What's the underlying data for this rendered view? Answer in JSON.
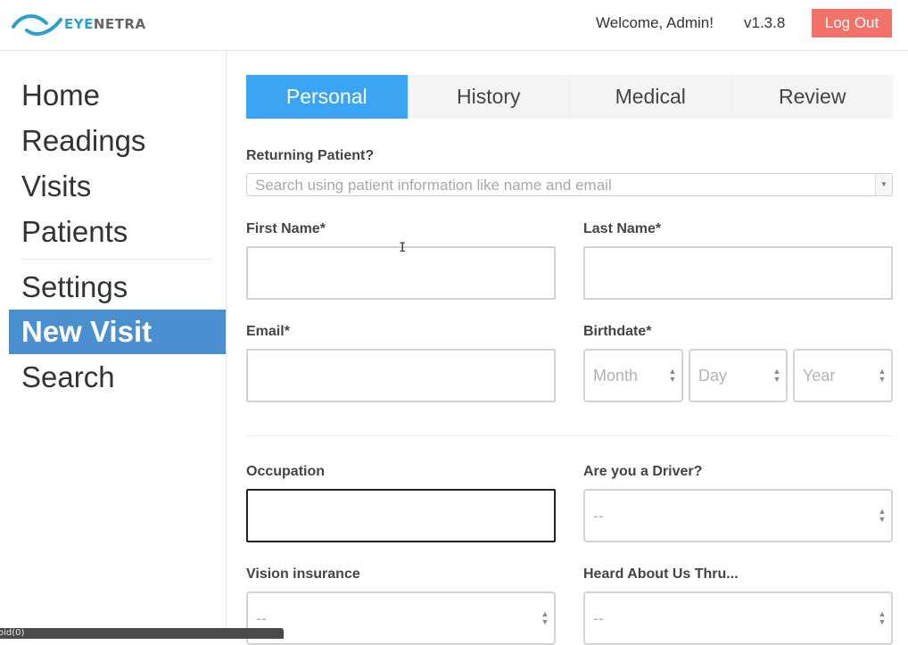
{
  "header": {
    "brand_prefix": "EYE",
    "brand_suffix": "NETRA",
    "welcome": "Welcome, Admin!",
    "version": "v1.3.8",
    "logout_label": "Log Out"
  },
  "sidebar": {
    "items": [
      {
        "label": "Home"
      },
      {
        "label": "Readings"
      },
      {
        "label": "Visits"
      },
      {
        "label": "Patients"
      },
      {
        "label": "Settings"
      },
      {
        "label": "New Visit"
      },
      {
        "label": "Search"
      }
    ],
    "active": "New Visit"
  },
  "tabs": [
    {
      "label": "Personal"
    },
    {
      "label": "History"
    },
    {
      "label": "Medical"
    },
    {
      "label": "Review"
    }
  ],
  "form": {
    "returning_label": "Returning Patient?",
    "returning_placeholder": "Search using patient information like name and email",
    "first_name_label": "First Name*",
    "last_name_label": "Last Name*",
    "email_label": "Email*",
    "birthdate_label": "Birthdate*",
    "month_placeholder": "Month",
    "day_placeholder": "Day",
    "year_placeholder": "Year",
    "occupation_label": "Occupation",
    "driver_label": "Are you a Driver?",
    "driver_value": "--",
    "vision_insurance_label": "Vision insurance",
    "vision_insurance_value": "--",
    "heard_label": "Heard About Us Thru...",
    "heard_value": "--"
  },
  "status_bar": {
    "text": "oid(0)"
  },
  "colors": {
    "accent_tab": "#3ba5f3",
    "sidebar_active": "#4a8fd0",
    "logout": "#f2726a",
    "brand": "#2aa0cf"
  }
}
